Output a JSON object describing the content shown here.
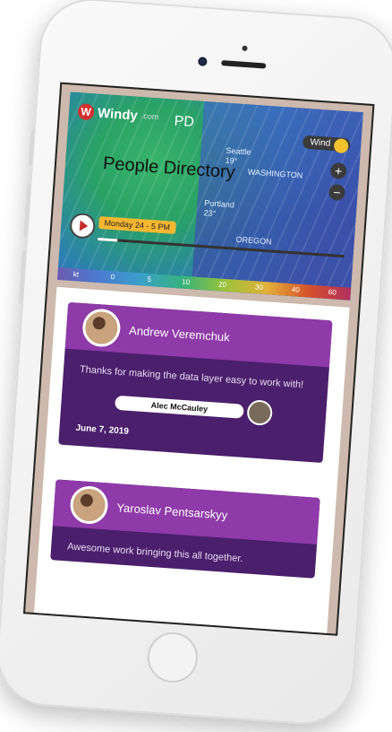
{
  "map": {
    "logo_text": "Windy",
    "logo_sub": ".com",
    "overlay_short": "PD",
    "title": "People Directory",
    "cities": [
      {
        "name": "Seattle",
        "temp": "19°"
      },
      {
        "name": "WASHINGTON",
        "temp": ""
      },
      {
        "name": "Portland",
        "temp": "23°"
      },
      {
        "name": "OREGON",
        "temp": ""
      }
    ],
    "layer_button": "Wind",
    "zoom_in": "+",
    "zoom_out": "−",
    "time_label": "Monday 24 - 5 PM",
    "timeline_progress": 0.08,
    "scale_unit": "kt",
    "scale_values": [
      "0",
      "5",
      "10",
      "20",
      "30",
      "40",
      "60"
    ]
  },
  "cards": [
    {
      "name": "Andrew Veremchuk",
      "message": "Thanks for making the data layer easy to work with!",
      "reply_to": "Alec McCauley",
      "date": "June 7, 2019"
    },
    {
      "name": "Yaroslav Pentsarskyy",
      "message": "Awesome work bringing this all together.",
      "reply_to": "",
      "date": ""
    }
  ],
  "colors": {
    "card_header": "#8e3aa8",
    "card_body": "#4a1f6b",
    "time_pill": "#f6b730"
  }
}
